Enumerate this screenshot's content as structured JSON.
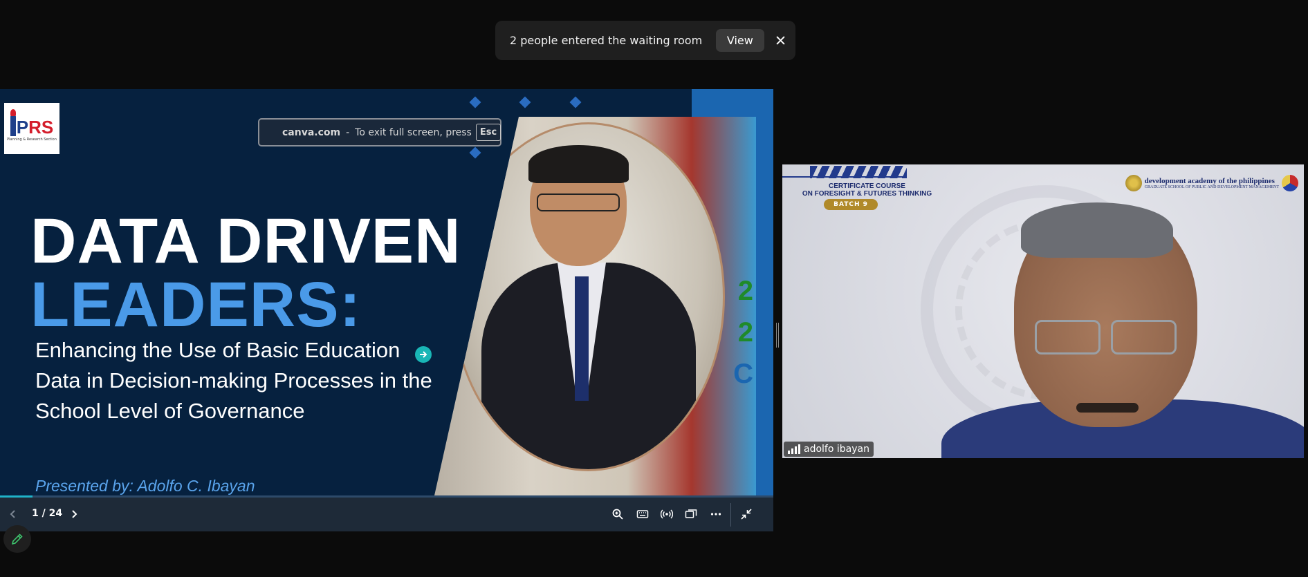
{
  "notification": {
    "text": "2 people entered the waiting room",
    "view_label": "View",
    "close_icon": "close-icon"
  },
  "slide": {
    "logo_letters_p": "P",
    "logo_letters_rs": "RS",
    "logo_sub": "Planning & Research Section",
    "fullscreen_host": "canva.com",
    "fullscreen_sep": "-",
    "fullscreen_text": "To exit full screen, press",
    "fullscreen_key": "Esc",
    "title_line1": "DATA DRIVEN",
    "title_line2": "LEADERS:",
    "subtitle": "Enhancing the Use of Basic Education Data in Decision-making Processes in the School Level of Governance",
    "presenter": "Presented by: Adolfo C. Ibayan",
    "photo_side_text": [
      "2",
      "2",
      "C"
    ],
    "colors": {
      "background": "#06213f",
      "accent": "#4a9ae8",
      "stripe": "#1b66b0"
    }
  },
  "controls": {
    "page_indicator": "1 / 24",
    "progress": 0.0417,
    "icons": [
      "chevron-left-icon",
      "chevron-right-icon",
      "zoom-in-icon",
      "keyboard-icon",
      "broadcast-icon",
      "present-icon",
      "more-icon",
      "exit-fullscreen-icon"
    ]
  },
  "video": {
    "cert_line1": "CERTIFICATE COURSE",
    "cert_line2": "ON FORESIGHT & FUTURES THINKING",
    "batch": "BATCH 9",
    "dap_line1": "development academy of the philippines",
    "dap_line2": "GRADUATE SCHOOL OF PUBLIC AND DEVELOPMENT MANAGEMENT",
    "participant_name": "adolfo ibayan"
  }
}
